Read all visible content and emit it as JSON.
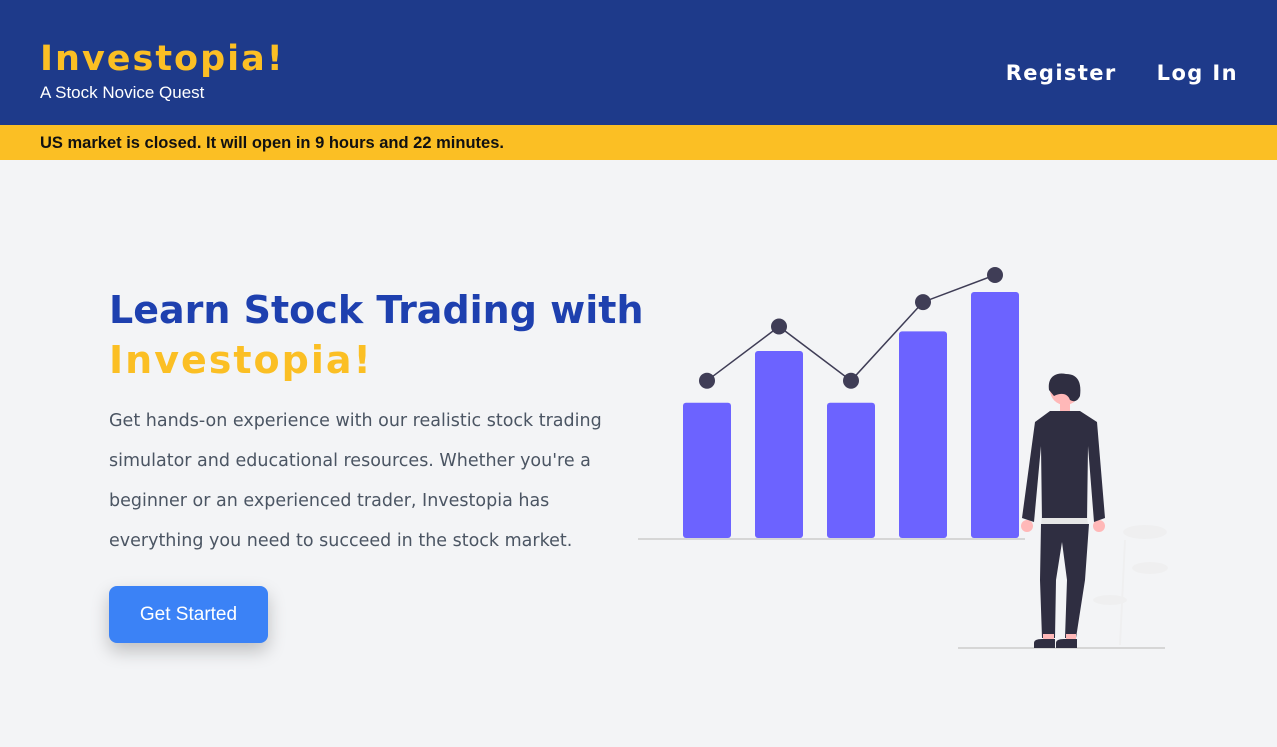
{
  "header": {
    "brand_title": "Investopia!",
    "brand_subtitle": "A Stock Novice Quest",
    "nav": {
      "register": "Register",
      "login": "Log In"
    }
  },
  "banner": {
    "text": "US market is closed. It will open in 9 hours and 22 minutes."
  },
  "hero": {
    "title_line1": "Learn Stock Trading with",
    "title_line2": "Investopia!",
    "description": "Get hands-on experience with our realistic stock trading simulator and educational resources. Whether you're a beginner or an experienced trader, Investopia has everything you need to succeed in the stock market.",
    "cta_label": "Get Started"
  },
  "illustration": {
    "bar_heights_relative": [
      0.55,
      0.76,
      0.55,
      0.84,
      1.0
    ],
    "dot_levels_relative": [
      0.61,
      0.81,
      0.61,
      0.9,
      1.0
    ],
    "colors": {
      "bars": "#6c63ff",
      "line": "#3f3d56",
      "figure": "#2f2e41",
      "skin": "#ffb8b8",
      "baseline": "#cccccc"
    }
  },
  "colors": {
    "header_bg": "#1e3a8a",
    "brand_yellow": "#fbbf24",
    "title_blue": "#1e40af",
    "button_blue": "#3b82f6",
    "page_bg": "#f3f4f6"
  }
}
